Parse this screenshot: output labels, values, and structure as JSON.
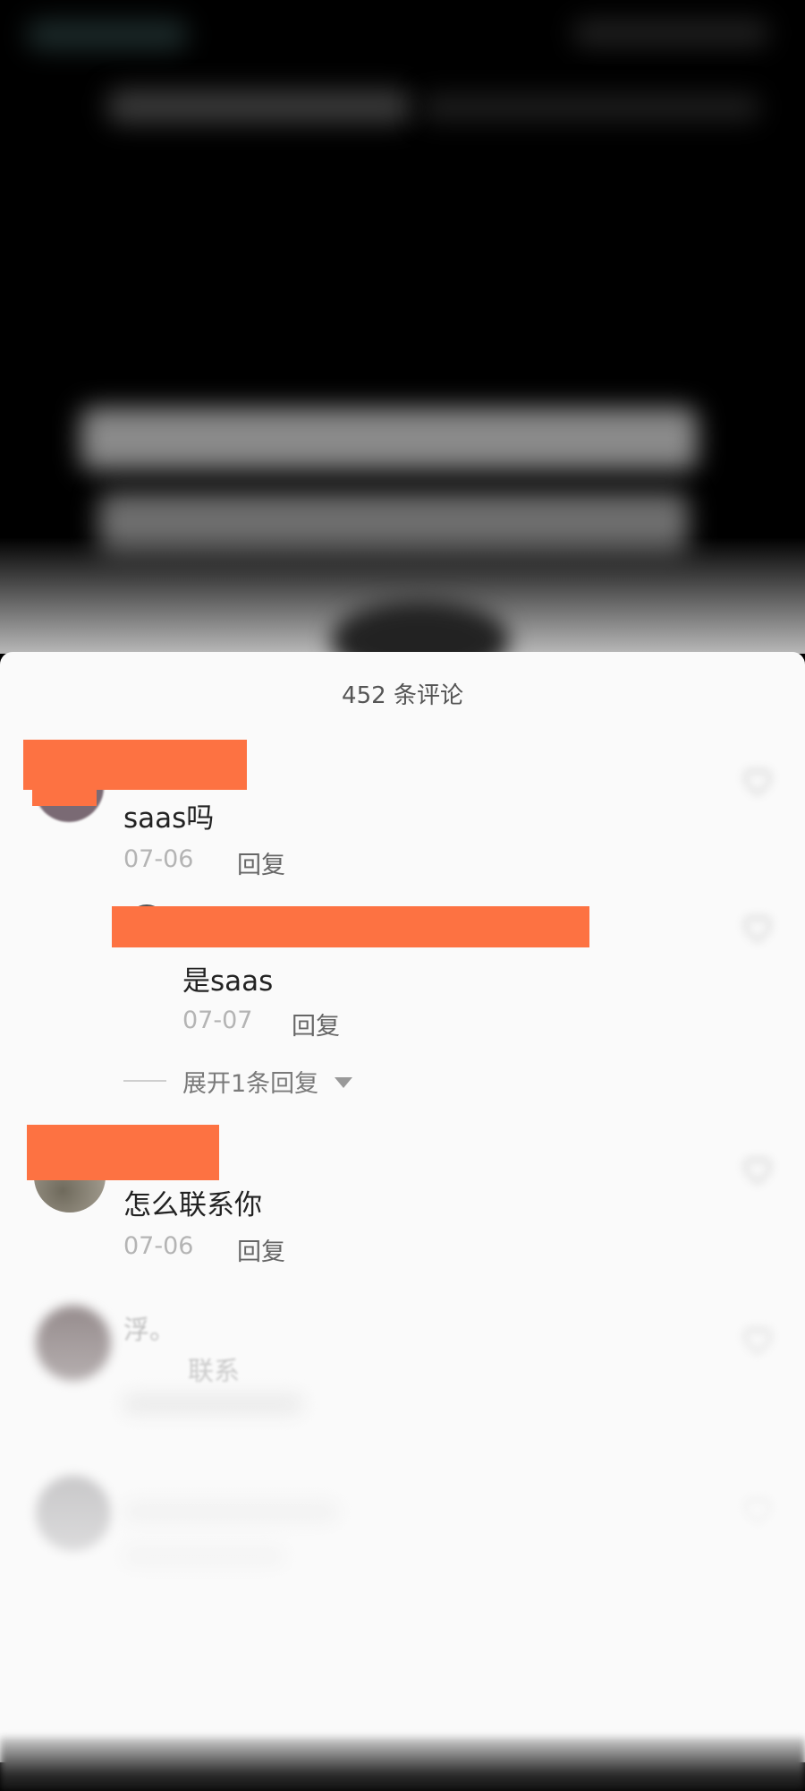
{
  "panel": {
    "title": "452 条评论"
  },
  "comments": [
    {
      "text": "saas吗",
      "date": "07-06",
      "reply_label": "回复",
      "replies": [
        {
          "text": "是saas",
          "date": "07-07",
          "reply_label": "回复"
        }
      ],
      "expand_label": "展开1条回复"
    },
    {
      "text": "怎么联系你",
      "date": "07-06",
      "reply_label": "回复"
    },
    {
      "text": "浮。",
      "text_line2": "联系"
    }
  ],
  "colors": {
    "redaction": "#fd7242",
    "panel_bg": "#fafafa",
    "video_bg": "#000000"
  },
  "icons": {
    "like": "heart-icon",
    "expand": "chevron-down-icon"
  }
}
